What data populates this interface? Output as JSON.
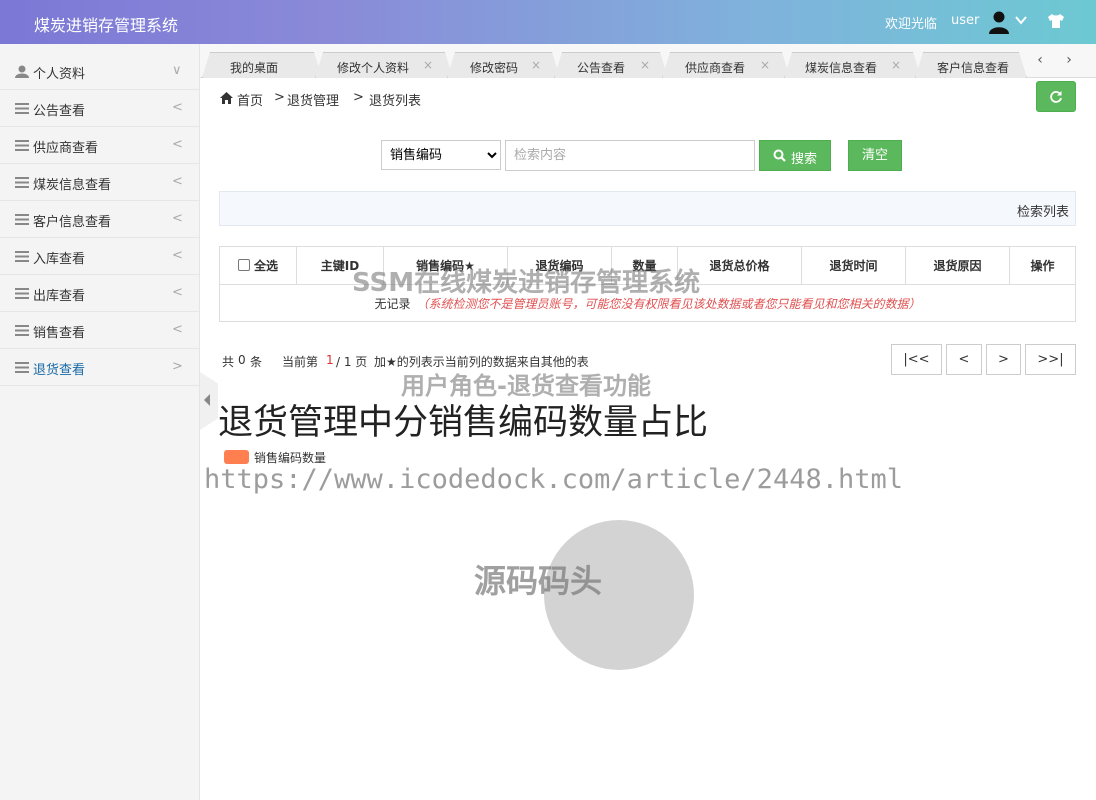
{
  "header": {
    "app_title": "煤炭进销存管理系统",
    "welcome": "欢迎光临",
    "username": "user"
  },
  "sidebar": {
    "items": [
      {
        "label": "个人资料",
        "arrow": "∨",
        "icon": "user-icon"
      },
      {
        "label": "公告查看",
        "arrow": "<",
        "icon": "menu-icon"
      },
      {
        "label": "供应商查看",
        "arrow": "<",
        "icon": "menu-icon"
      },
      {
        "label": "煤炭信息查看",
        "arrow": "<",
        "icon": "menu-icon"
      },
      {
        "label": "客户信息查看",
        "arrow": "<",
        "icon": "menu-icon"
      },
      {
        "label": "入库查看",
        "arrow": "<",
        "icon": "menu-icon"
      },
      {
        "label": "出库查看",
        "arrow": "<",
        "icon": "menu-icon"
      },
      {
        "label": "销售查看",
        "arrow": "<",
        "icon": "menu-icon"
      },
      {
        "label": "退货查看",
        "arrow": ">",
        "icon": "menu-icon",
        "active": true
      }
    ]
  },
  "tabs": [
    {
      "label": "我的桌面"
    },
    {
      "label": "修改个人资料",
      "close": "×"
    },
    {
      "label": "修改密码",
      "close": "×"
    },
    {
      "label": "公告查看",
      "close": "×"
    },
    {
      "label": "供应商查看",
      "close": "×"
    },
    {
      "label": "煤炭信息查看",
      "close": "×"
    },
    {
      "label": "客户信息查看"
    }
  ],
  "tab_nav": {
    "prev": "‹",
    "next": "›"
  },
  "breadcrumb": {
    "home": "首页",
    "sep1": ">",
    "level1": "退货管理",
    "sep2": ">",
    "level2": "退货列表"
  },
  "search": {
    "field_selected": "销售编码",
    "placeholder": "检索内容",
    "search_label": "搜索",
    "clear_label": "清空"
  },
  "list_bar": {
    "label": "检索列表"
  },
  "table": {
    "select_all": "全选",
    "columns": [
      "主键ID",
      "销售编码★",
      "退货编码",
      "数量",
      "退货总价格",
      "退货时间",
      "退货原因",
      "操作"
    ],
    "no_record": "无记录",
    "permission_note": "（系统检测您不是管理员账号，可能您没有权限看见该处数据或者您只能看见和您相关的数据）"
  },
  "pagination": {
    "total_prefix": "共",
    "total": "0",
    "total_suffix": "条",
    "current_prefix": "当前第",
    "current": "1",
    "pages": "/ 1 页",
    "note": "加★的列表示当前列的数据来自其他的表",
    "first": "|<<",
    "prev": "<",
    "next": ">",
    "last": ">>|"
  },
  "chart_data": {
    "type": "pie",
    "title": "退货管理中分销售编码数量占比",
    "legend": [
      "销售编码数量"
    ],
    "series": [
      {
        "name": "销售编码数量",
        "values": []
      }
    ],
    "colors": [
      "#ff7f50"
    ],
    "placeholder_color": "#d3d3d3",
    "legend_position": "top-left"
  },
  "watermarks": {
    "w1": "SSM在线煤炭进销存管理系统",
    "w2": "用户角色-退货查看功能",
    "w3": "https://www.icodedock.com/article/2448.html",
    "w4": "源码码头"
  }
}
